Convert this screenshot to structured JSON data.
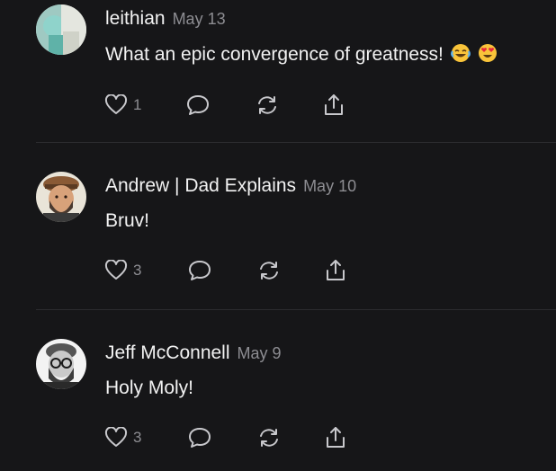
{
  "comments": [
    {
      "author": "leithian",
      "date": "May 13",
      "text": "What an epic convergence of greatness!",
      "emojis": [
        "tears-of-joy-emoji",
        "heart-eyes-emoji"
      ],
      "likes": "1",
      "avatar_icon": "avatar-leithian"
    },
    {
      "author": "Andrew | Dad Explains",
      "date": "May 10",
      "text": "Bruv!",
      "likes": "3",
      "avatar_icon": "avatar-andrew"
    },
    {
      "author": "Jeff McConnell",
      "date": "May 9",
      "text": "Holy Moly!",
      "likes": "3",
      "avatar_icon": "avatar-jeff"
    }
  ],
  "icons": {
    "like": "heart-icon",
    "reply": "speech-bubble-icon",
    "restack": "restack-icon",
    "share": "share-icon"
  },
  "colors": {
    "background": "#161618",
    "text": "#f2f2f2",
    "muted": "#8d8d92",
    "divider": "#2c2c2f"
  }
}
